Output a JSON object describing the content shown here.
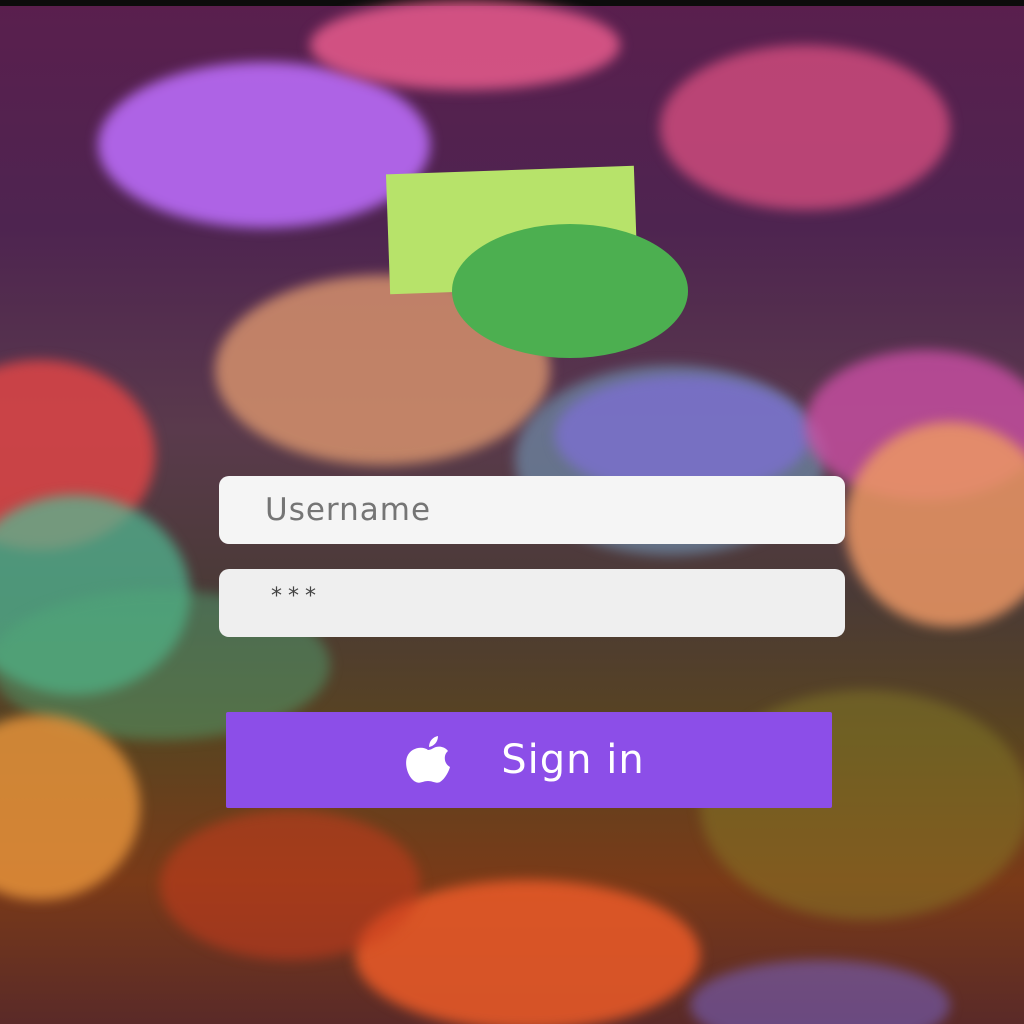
{
  "login": {
    "username_placeholder": "Username",
    "password_value": "***",
    "signin_label": "Sign in",
    "signin_icon": "apple-icon"
  },
  "colors": {
    "logo_square": "#b7e36a",
    "logo_circle": "#4caf50",
    "button": "#8c4ee8",
    "field_background": "#f5f5f5"
  }
}
